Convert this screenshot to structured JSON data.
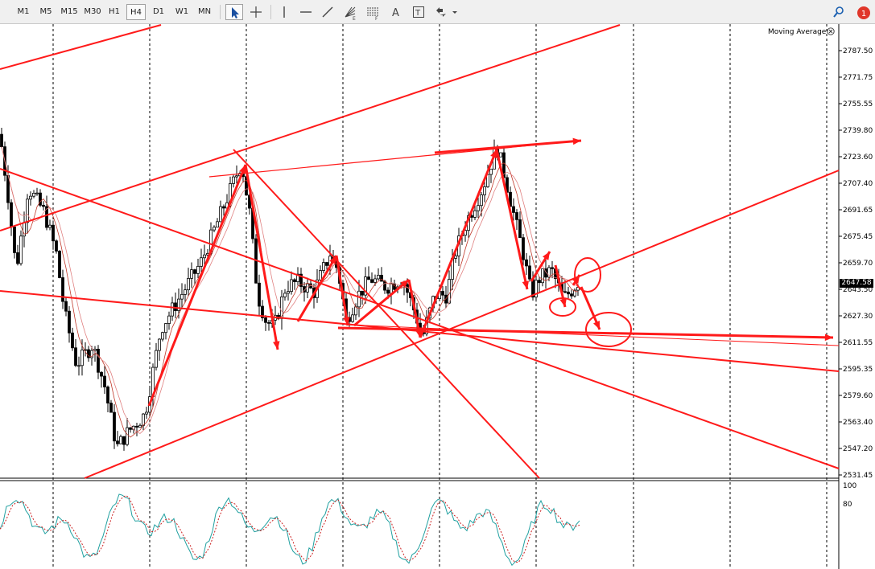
{
  "toolbar": {
    "timeframes": [
      "M1",
      "M5",
      "M15",
      "M30",
      "H1",
      "H4",
      "D1",
      "W1",
      "MN"
    ],
    "active_timeframe": "H4",
    "tools": [
      "cursor-icon",
      "crosshair-icon",
      "vertical-line-icon",
      "horizontal-line-icon",
      "trendline-icon",
      "gann-fan-icon",
      "fibonacci-icon",
      "text-icon",
      "text-label-icon",
      "arrows-icon"
    ],
    "tool_sub": {
      "gann": "E",
      "fibo": "F"
    },
    "search_icon": "search-icon",
    "notification_count": "1"
  },
  "indicator": {
    "name": "Moving Average"
  },
  "price_axis": {
    "ticks": [
      "2787.50",
      "2771.75",
      "2755.55",
      "2739.80",
      "2723.60",
      "2707.40",
      "2691.65",
      "2675.45",
      "2659.70",
      "2643.50",
      "2627.30",
      "2611.55",
      "2595.35",
      "2579.60",
      "2563.40",
      "2547.20",
      "2531.45"
    ],
    "current_price": "2647.58"
  },
  "oscillator_axis": {
    "ticks": [
      "100",
      "80"
    ]
  },
  "colors": {
    "annotation": "#ff1a1a",
    "candle": "#000000",
    "ma": "#c0392b",
    "osc_main": "#20a0a0",
    "osc_signal": "#cc2222",
    "grid": "#000000"
  }
}
